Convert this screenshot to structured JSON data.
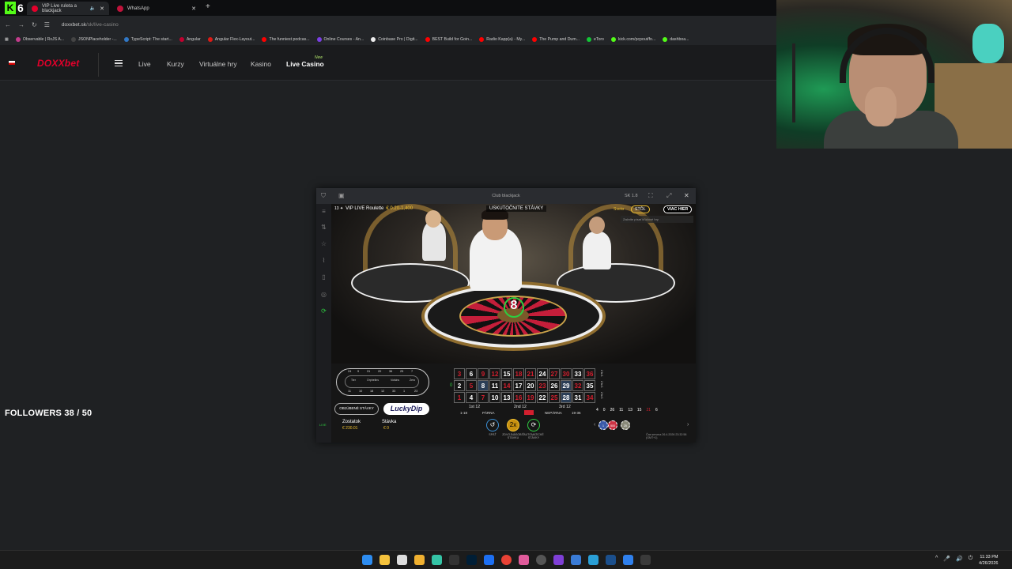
{
  "browser": {
    "tabs": [
      {
        "title": "VIP Live ruleta a blackjack",
        "active": true
      },
      {
        "title": "WhatsApp",
        "active": false
      }
    ],
    "close_glyph": "✕",
    "new_tab_glyph": "+",
    "url_host": "doxxbet.sk",
    "url_path": "/sk/live-casino",
    "bookmarks": [
      "Observable | RxJS A...",
      "JSONPlaceholder -...",
      "TypeScript: The start...",
      "Angular",
      "Angular Flex-Layout...",
      "The funniest podcas...",
      "Online Courses - An...",
      "Coinbase Pro | Digit...",
      "BEST Build for Goin...",
      "Radio Kapp(a) - My...",
      "The Pump and Dum...",
      "eToro",
      "kick.com/pcpout/fo...",
      "dashboa..."
    ]
  },
  "site": {
    "logo": "DOXXbet",
    "nav": [
      "Live",
      "Kurzy",
      "Virtuálne hry",
      "Kasino",
      "Live Casino"
    ],
    "new_badge": "New"
  },
  "overlay": {
    "followers": "FOLLOWERS 38 / 50"
  },
  "game": {
    "window_title": "Club blackjack",
    "window_code": "SK 1.8",
    "table_badge": "13 ✦",
    "table_name": "VIP LIVE Roulette",
    "limits": "€ 0.20-1,400",
    "status": "USKUTOČNITE STÁVKY",
    "top_links": {
      "sveto": "Sveto",
      "stol": "STÔL",
      "viac": "VIAC HIER"
    },
    "search_placeholder": "Začnite písať kľúčové hry",
    "result_number": "8",
    "racetrack_labels": [
      "Tier",
      "Orphelins",
      "Voisins",
      "Zero"
    ],
    "grid_rows": [
      [
        "3",
        "6",
        "9",
        "12",
        "15",
        "18",
        "21",
        "24",
        "27",
        "30",
        "33",
        "36"
      ],
      [
        "2",
        "5",
        "8",
        "11",
        "14",
        "17",
        "20",
        "23",
        "26",
        "29",
        "32",
        "35"
      ],
      [
        "1",
        "4",
        "7",
        "10",
        "13",
        "16",
        "19",
        "22",
        "25",
        "28",
        "31",
        "34"
      ]
    ],
    "red_numbers": [
      "1",
      "3",
      "5",
      "7",
      "9",
      "12",
      "14",
      "16",
      "18",
      "19",
      "21",
      "23",
      "25",
      "27",
      "30",
      "32",
      "34",
      "36"
    ],
    "highlighted_numbers": [
      "8",
      "28",
      "29"
    ],
    "zero": "0",
    "column_label": "2 to 1",
    "dozens": [
      "1st 12",
      "2nd 12",
      "3rd 12"
    ],
    "outside_bets": [
      "1-18",
      "PÁRNA",
      "NEPÁRNA",
      "19-36"
    ],
    "btn_favorite": "OBĽÚBENÉ STÁVKY",
    "btn_luckydip": "LuckyDip",
    "balance_label": "Zostatok",
    "balance_value": "€ 230.01",
    "stake_label": "Stávka",
    "stake_value": "€ 0",
    "round_buttons": [
      {
        "glyph": "↺",
        "label": "SPÄŤ"
      },
      {
        "glyph": "2x",
        "label": "ZDVOJNÁSOBIŤ STÁVKU"
      },
      {
        "glyph": "⟳",
        "label": "AUTOMATICKÉ STÁVKY"
      }
    ],
    "history": [
      "4",
      "0",
      "26",
      "11",
      "13",
      "15",
      "21",
      "6"
    ],
    "history_red": [
      "21"
    ],
    "chips": [
      "1",
      "500",
      "25"
    ],
    "game_time": "Čas servera 26.4.2026 23:32:58 (GMT+1)",
    "live_tag": "LIVE"
  },
  "taskbar": {
    "time": "11:33 PM",
    "date": "4/26/2026",
    "tray": [
      "^",
      "🎤",
      "🔊",
      "⏻"
    ]
  },
  "colors": {
    "brand_red": "#e4002b",
    "accent_gold": "#f1c232",
    "kick_green": "#53fc18",
    "table_red": "#d21f2e"
  }
}
